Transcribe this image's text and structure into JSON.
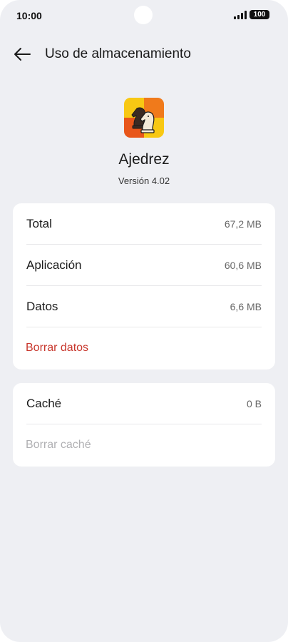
{
  "status_bar": {
    "time": "10:00",
    "battery": "100",
    "signal_icon": "signal-bars-icon"
  },
  "header": {
    "back_icon": "arrow-left-icon",
    "title": "Uso de almacenamiento"
  },
  "app": {
    "icon": "chess-knights-icon",
    "name": "Ajedrez",
    "version": "Versión 4.02"
  },
  "storage": {
    "rows": [
      {
        "label": "Total",
        "value": "67,2 MB"
      },
      {
        "label": "Aplicación",
        "value": "60,6 MB"
      },
      {
        "label": "Datos",
        "value": "6,6 MB"
      }
    ],
    "clear_data_label": "Borrar datos"
  },
  "cache": {
    "label": "Caché",
    "value": "0 B",
    "clear_cache_label": "Borrar caché"
  },
  "colors": {
    "background": "#eeeff3",
    "card": "#ffffff",
    "danger": "#c8372d",
    "disabled": "#b0b0b3"
  }
}
